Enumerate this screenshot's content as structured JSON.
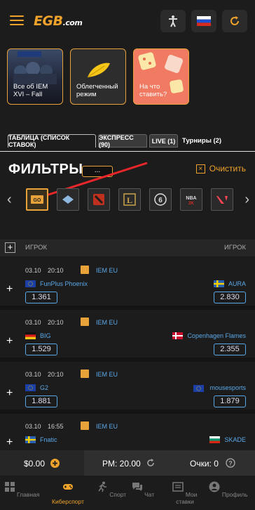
{
  "header": {
    "logo": "EGB",
    "logo_suffix": ".com"
  },
  "promos": [
    {
      "label": "Все об IEM XVI – Fall"
    },
    {
      "label": "Облегченный режим"
    },
    {
      "label": "На что ставить?"
    }
  ],
  "tabs": [
    {
      "label": "ТАБЛИЦА (СПИСОК СТАВОК)"
    },
    {
      "label": "ЭКСПРЕСС (90)"
    },
    {
      "label": "LIVE (1)"
    },
    {
      "label": "Турниры (2)"
    }
  ],
  "filters": {
    "title": "ФИЛЬТРЫ",
    "dots": "...",
    "clear_label": "Очистить"
  },
  "games": [
    {
      "name": "cs-go",
      "label": "CS"
    },
    {
      "name": "starcraft",
      "label": "SC"
    },
    {
      "name": "dota",
      "label": "D"
    },
    {
      "name": "lol",
      "label": "L"
    },
    {
      "name": "rainbow-six",
      "label": "R6"
    },
    {
      "name": "nba2k",
      "label": "NBA"
    },
    {
      "name": "valorant",
      "label": "V"
    }
  ],
  "list_header": {
    "left": "ИГРОК",
    "right": "ИГРОК"
  },
  "matches": [
    {
      "date": "03.10",
      "time": "20:10",
      "league": "IEM EU",
      "team1": "FunPlus Phoenix",
      "team2": "AURA",
      "odd1": "1.361",
      "odd2": "2.830",
      "flag1": "eu",
      "flag2": "se"
    },
    {
      "date": "03.10",
      "time": "20:10",
      "league": "IEM EU",
      "team1": "BIG",
      "team2": "Copenhagen Flames",
      "odd1": "1.529",
      "odd2": "2.355",
      "flag1": "de",
      "flag2": "dk"
    },
    {
      "date": "03.10",
      "time": "20:10",
      "league": "IEM EU",
      "team1": "G2",
      "team2": "mousesports",
      "odd1": "1.881",
      "odd2": "1.879",
      "flag1": "eu",
      "flag2": "eu"
    },
    {
      "date": "03.10",
      "time": "16:55",
      "league": "IEM EU",
      "team1": "Fnatic",
      "team2": "SKADE",
      "odd1": "",
      "odd2": "",
      "flag1": "se",
      "flag2": "bg"
    }
  ],
  "balance": {
    "money": "$0.00",
    "pm": "PM: 20.00",
    "points": "Очки: 0"
  },
  "nav": [
    {
      "label": "Главная"
    },
    {
      "label": "Киберспорт"
    },
    {
      "label": "Спорт"
    },
    {
      "label": "Чат"
    },
    {
      "label": "Мои ставки"
    },
    {
      "label": "Профиль"
    }
  ],
  "colors": {
    "accent": "#f0a32a",
    "link": "#5aa8e8",
    "background": "#1c1c1c"
  }
}
